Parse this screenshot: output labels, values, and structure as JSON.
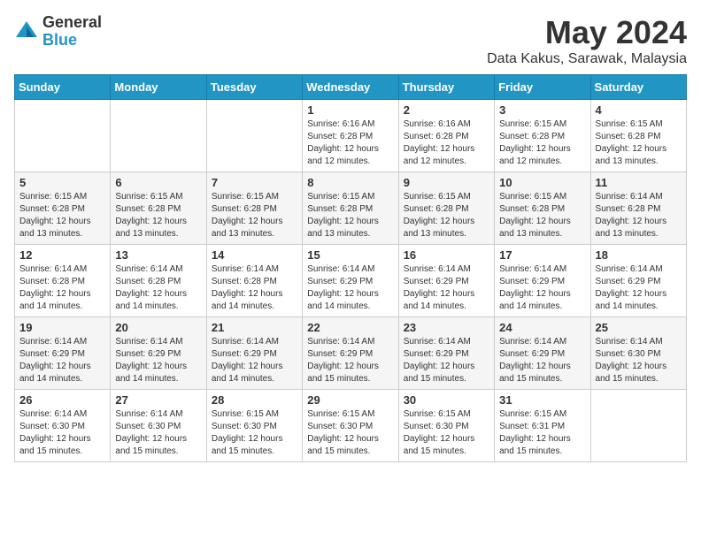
{
  "logo": {
    "general": "General",
    "blue": "Blue"
  },
  "title": {
    "month_year": "May 2024",
    "location": "Data Kakus, Sarawak, Malaysia"
  },
  "weekdays": [
    "Sunday",
    "Monday",
    "Tuesday",
    "Wednesday",
    "Thursday",
    "Friday",
    "Saturday"
  ],
  "weeks": [
    [
      {
        "day": "",
        "info": ""
      },
      {
        "day": "",
        "info": ""
      },
      {
        "day": "",
        "info": ""
      },
      {
        "day": "1",
        "info": "Sunrise: 6:16 AM\nSunset: 6:28 PM\nDaylight: 12 hours and 12 minutes."
      },
      {
        "day": "2",
        "info": "Sunrise: 6:16 AM\nSunset: 6:28 PM\nDaylight: 12 hours and 12 minutes."
      },
      {
        "day": "3",
        "info": "Sunrise: 6:15 AM\nSunset: 6:28 PM\nDaylight: 12 hours and 12 minutes."
      },
      {
        "day": "4",
        "info": "Sunrise: 6:15 AM\nSunset: 6:28 PM\nDaylight: 12 hours and 13 minutes."
      }
    ],
    [
      {
        "day": "5",
        "info": "Sunrise: 6:15 AM\nSunset: 6:28 PM\nDaylight: 12 hours and 13 minutes."
      },
      {
        "day": "6",
        "info": "Sunrise: 6:15 AM\nSunset: 6:28 PM\nDaylight: 12 hours and 13 minutes."
      },
      {
        "day": "7",
        "info": "Sunrise: 6:15 AM\nSunset: 6:28 PM\nDaylight: 12 hours and 13 minutes."
      },
      {
        "day": "8",
        "info": "Sunrise: 6:15 AM\nSunset: 6:28 PM\nDaylight: 12 hours and 13 minutes."
      },
      {
        "day": "9",
        "info": "Sunrise: 6:15 AM\nSunset: 6:28 PM\nDaylight: 12 hours and 13 minutes."
      },
      {
        "day": "10",
        "info": "Sunrise: 6:15 AM\nSunset: 6:28 PM\nDaylight: 12 hours and 13 minutes."
      },
      {
        "day": "11",
        "info": "Sunrise: 6:14 AM\nSunset: 6:28 PM\nDaylight: 12 hours and 13 minutes."
      }
    ],
    [
      {
        "day": "12",
        "info": "Sunrise: 6:14 AM\nSunset: 6:28 PM\nDaylight: 12 hours and 14 minutes."
      },
      {
        "day": "13",
        "info": "Sunrise: 6:14 AM\nSunset: 6:28 PM\nDaylight: 12 hours and 14 minutes."
      },
      {
        "day": "14",
        "info": "Sunrise: 6:14 AM\nSunset: 6:28 PM\nDaylight: 12 hours and 14 minutes."
      },
      {
        "day": "15",
        "info": "Sunrise: 6:14 AM\nSunset: 6:29 PM\nDaylight: 12 hours and 14 minutes."
      },
      {
        "day": "16",
        "info": "Sunrise: 6:14 AM\nSunset: 6:29 PM\nDaylight: 12 hours and 14 minutes."
      },
      {
        "day": "17",
        "info": "Sunrise: 6:14 AM\nSunset: 6:29 PM\nDaylight: 12 hours and 14 minutes."
      },
      {
        "day": "18",
        "info": "Sunrise: 6:14 AM\nSunset: 6:29 PM\nDaylight: 12 hours and 14 minutes."
      }
    ],
    [
      {
        "day": "19",
        "info": "Sunrise: 6:14 AM\nSunset: 6:29 PM\nDaylight: 12 hours and 14 minutes."
      },
      {
        "day": "20",
        "info": "Sunrise: 6:14 AM\nSunset: 6:29 PM\nDaylight: 12 hours and 14 minutes."
      },
      {
        "day": "21",
        "info": "Sunrise: 6:14 AM\nSunset: 6:29 PM\nDaylight: 12 hours and 14 minutes."
      },
      {
        "day": "22",
        "info": "Sunrise: 6:14 AM\nSunset: 6:29 PM\nDaylight: 12 hours and 15 minutes."
      },
      {
        "day": "23",
        "info": "Sunrise: 6:14 AM\nSunset: 6:29 PM\nDaylight: 12 hours and 15 minutes."
      },
      {
        "day": "24",
        "info": "Sunrise: 6:14 AM\nSunset: 6:29 PM\nDaylight: 12 hours and 15 minutes."
      },
      {
        "day": "25",
        "info": "Sunrise: 6:14 AM\nSunset: 6:30 PM\nDaylight: 12 hours and 15 minutes."
      }
    ],
    [
      {
        "day": "26",
        "info": "Sunrise: 6:14 AM\nSunset: 6:30 PM\nDaylight: 12 hours and 15 minutes."
      },
      {
        "day": "27",
        "info": "Sunrise: 6:14 AM\nSunset: 6:30 PM\nDaylight: 12 hours and 15 minutes."
      },
      {
        "day": "28",
        "info": "Sunrise: 6:15 AM\nSunset: 6:30 PM\nDaylight: 12 hours and 15 minutes."
      },
      {
        "day": "29",
        "info": "Sunrise: 6:15 AM\nSunset: 6:30 PM\nDaylight: 12 hours and 15 minutes."
      },
      {
        "day": "30",
        "info": "Sunrise: 6:15 AM\nSunset: 6:30 PM\nDaylight: 12 hours and 15 minutes."
      },
      {
        "day": "31",
        "info": "Sunrise: 6:15 AM\nSunset: 6:31 PM\nDaylight: 12 hours and 15 minutes."
      },
      {
        "day": "",
        "info": ""
      }
    ]
  ]
}
